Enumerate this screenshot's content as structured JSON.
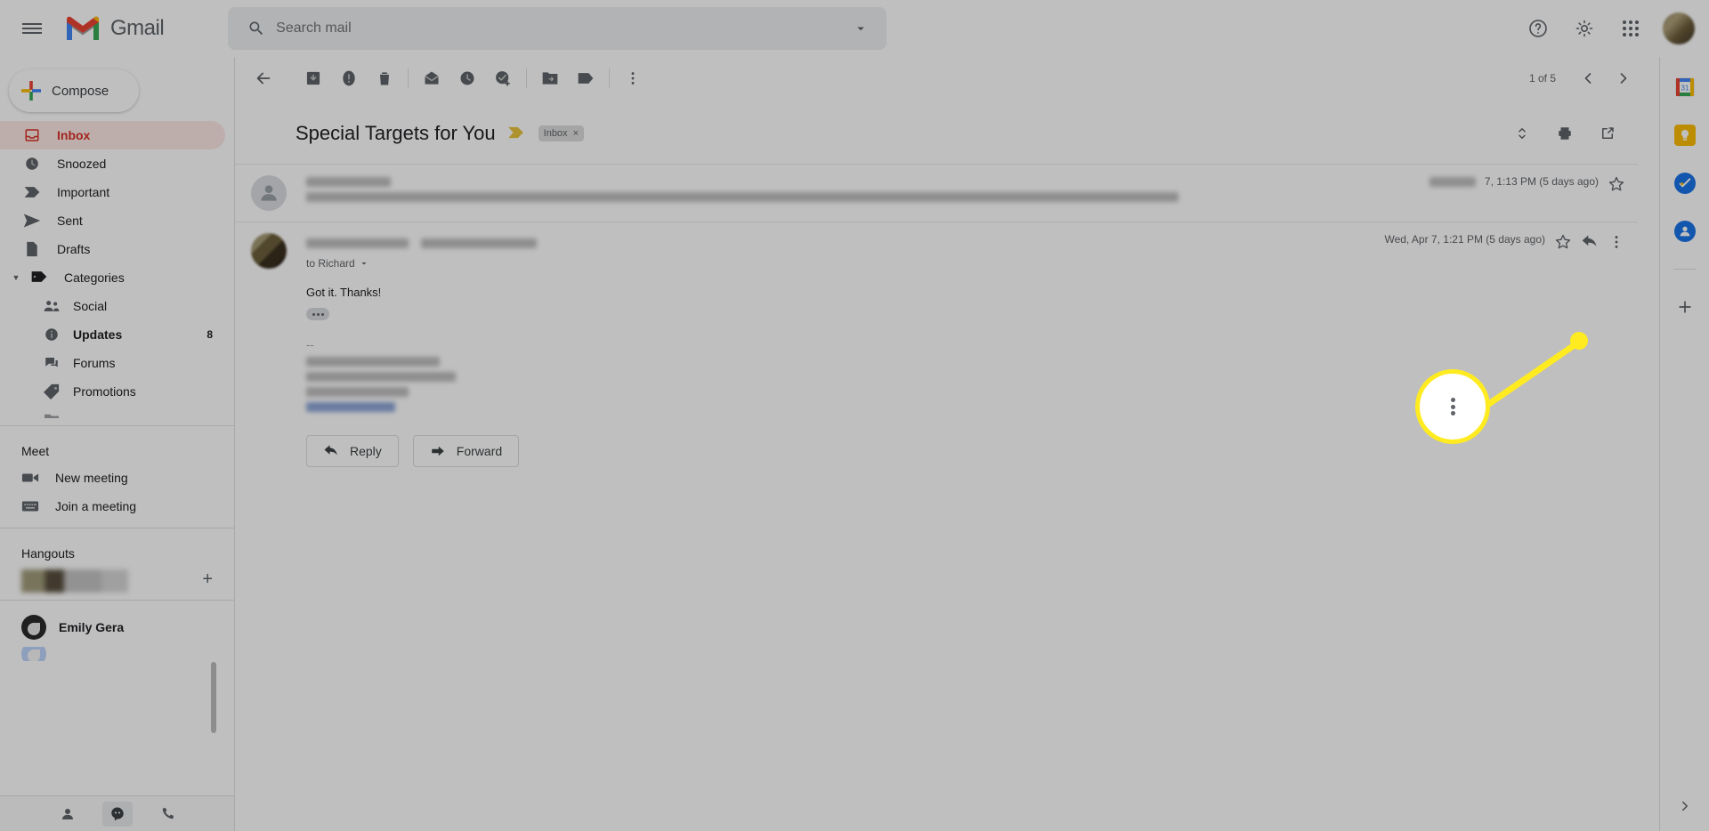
{
  "app": {
    "name": "Gmail"
  },
  "topbar": {
    "menu_icon": "hamburger-icon",
    "logo_icon": "gmail-logo-icon",
    "search_placeholder": "Search mail",
    "search_value": "",
    "search_icon": "search-icon",
    "search_options_icon": "chevron-down-icon",
    "help_icon": "help-icon",
    "settings_icon": "gear-icon",
    "apps_icon": "apps-grid-icon",
    "avatar_icon": "account-avatar"
  },
  "sidebar": {
    "compose_label": "Compose",
    "items": [
      {
        "label": "Inbox",
        "icon": "inbox-icon",
        "active": true,
        "count": ""
      },
      {
        "label": "Snoozed",
        "icon": "clock-icon",
        "active": false,
        "count": ""
      },
      {
        "label": "Important",
        "icon": "important-icon",
        "active": false,
        "count": ""
      },
      {
        "label": "Sent",
        "icon": "send-icon",
        "active": false,
        "count": ""
      },
      {
        "label": "Drafts",
        "icon": "draft-icon",
        "active": false,
        "count": ""
      }
    ],
    "categories_label": "Categories",
    "categories": [
      {
        "label": "Social",
        "icon": "people-icon",
        "count": ""
      },
      {
        "label": "Updates",
        "icon": "info-icon",
        "count": "8"
      },
      {
        "label": "Forums",
        "icon": "forum-icon",
        "count": ""
      },
      {
        "label": "Promotions",
        "icon": "tag-icon",
        "count": ""
      }
    ],
    "meet": {
      "title": "Meet",
      "items": [
        {
          "label": "New meeting",
          "icon": "video-camera-icon"
        },
        {
          "label": "Join a meeting",
          "icon": "keyboard-icon"
        }
      ]
    },
    "hangouts": {
      "title": "Hangouts",
      "contact_name": "Emily Gera",
      "add_icon": "plus-icon"
    },
    "chat_bar": {
      "contacts_icon": "person-icon",
      "chat_icon": "hangouts-icon",
      "phone_icon": "phone-icon"
    }
  },
  "toolbar": {
    "back_icon": "back-arrow-icon",
    "archive_icon": "archive-icon",
    "spam_icon": "report-spam-icon",
    "delete_icon": "trash-icon",
    "mark_unread_icon": "mark-unread-icon",
    "snooze_icon": "snooze-clock-icon",
    "tasks_icon": "add-to-tasks-icon",
    "move_icon": "move-to-folder-icon",
    "labels_icon": "labels-tag-icon",
    "more_icon": "more-vertical-icon",
    "pager_text": "1 of 5",
    "prev_icon": "chevron-left-icon",
    "next_icon": "chevron-right-icon"
  },
  "thread": {
    "subject": "Special Targets for You",
    "importance_icon": "important-marker-icon",
    "label_chip": "Inbox",
    "label_chip_remove": "×",
    "collapse_icon": "expand-collapse-icon",
    "print_icon": "print-icon",
    "popout_icon": "open-in-new-window-icon",
    "messages": [
      {
        "state": "collapsed",
        "sender": "",
        "timestamp": "7, 1:13 PM (5 days ago)",
        "star_icon": "star-outline-icon"
      },
      {
        "state": "expanded",
        "sender": "",
        "to_line": "to Richard",
        "to_caret_icon": "chevron-down-icon",
        "timestamp": "Wed, Apr 7, 1:21 PM (5 days ago)",
        "star_icon": "star-outline-icon",
        "reply_icon": "reply-arrow-icon",
        "more_icon": "more-vertical-icon",
        "body_text": "Got it. Thanks!",
        "expand_dots_icon": "show-trimmed-content-icon",
        "signature_dash": "--"
      }
    ],
    "reply_button": "Reply",
    "forward_button": "Forward",
    "reply_button_icon": "reply-arrow-icon",
    "forward_button_icon": "forward-arrow-icon"
  },
  "rail": {
    "calendar_icon": "google-calendar-icon",
    "calendar_day": "31",
    "keep_icon": "google-keep-icon",
    "tasks_icon": "google-tasks-icon",
    "contacts_icon": "google-contacts-icon",
    "add_icon": "add-addon-icon",
    "expand_icon": "chevron-right-icon"
  },
  "annotation": {
    "highlight_icon": "more-vertical-icon",
    "color": "#ffeb1f"
  },
  "colors": {
    "accent_red": "#d93025",
    "inbox_bg": "#fce8e6",
    "highlight": "#ffeb1f",
    "text": "#202124",
    "muted": "#5f6368"
  }
}
